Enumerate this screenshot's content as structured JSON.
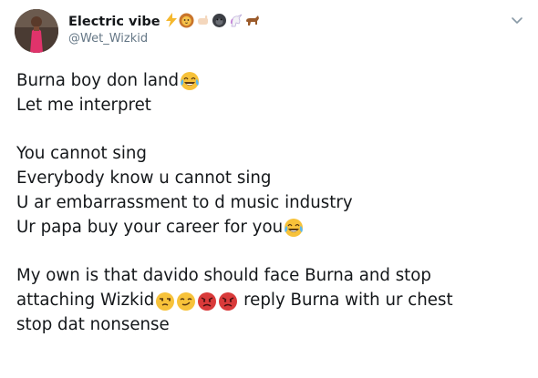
{
  "author": {
    "display_name": "Electric vibe",
    "handle": "@Wet_Wizkid",
    "name_badges": [
      "lightning-icon",
      "lion-face-icon",
      "hand-emoji-icon",
      "gorilla-icon",
      "unicorn-icon",
      "horse-icon"
    ]
  },
  "menu": {
    "icon": "chevron-down-icon"
  },
  "tweet": {
    "lines": [
      "Burna boy don land",
      "Let me interpret",
      "",
      "You cannot sing",
      "Everybody know u cannot sing",
      "U ar embarrassment to d music industry",
      "Ur papa buy your career for you",
      "",
      "My own is that davido should face Burna and stop",
      "attaching Wizkid",
      " reply Burna with ur chest",
      "stop dat nonsense"
    ],
    "emojis": {
      "line1": [
        "face-with-tears-of-joy-icon"
      ],
      "line7": [
        "face-with-tears-of-joy-icon"
      ],
      "line10": [
        "unamused-face-icon",
        "smirking-face-icon",
        "pouting-face-icon",
        "pouting-face-icon"
      ]
    }
  },
  "colors": {
    "text": "#14171a",
    "secondary": "#657786",
    "emoji_yellow": "#f7c23a",
    "emoji_red": "#d93a3a"
  }
}
